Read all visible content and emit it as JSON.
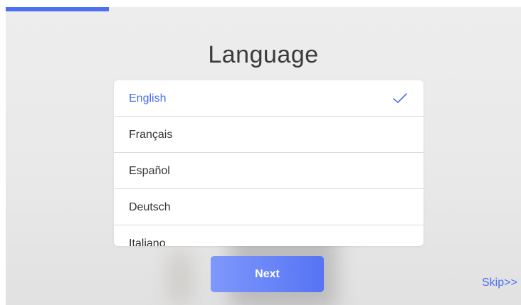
{
  "setup": {
    "progress_fraction": 0.2,
    "accent_color": "#4d6ff2"
  },
  "page": {
    "title": "Language"
  },
  "languages": {
    "items": [
      {
        "label": "English",
        "selected": true
      },
      {
        "label": "Français",
        "selected": false
      },
      {
        "label": "Español",
        "selected": false
      },
      {
        "label": "Deutsch",
        "selected": false
      },
      {
        "label": "Italiano",
        "selected": false
      }
    ],
    "selected_icon": "check-icon"
  },
  "footer": {
    "next_label": "Next",
    "skip_label": "Skip>>"
  }
}
